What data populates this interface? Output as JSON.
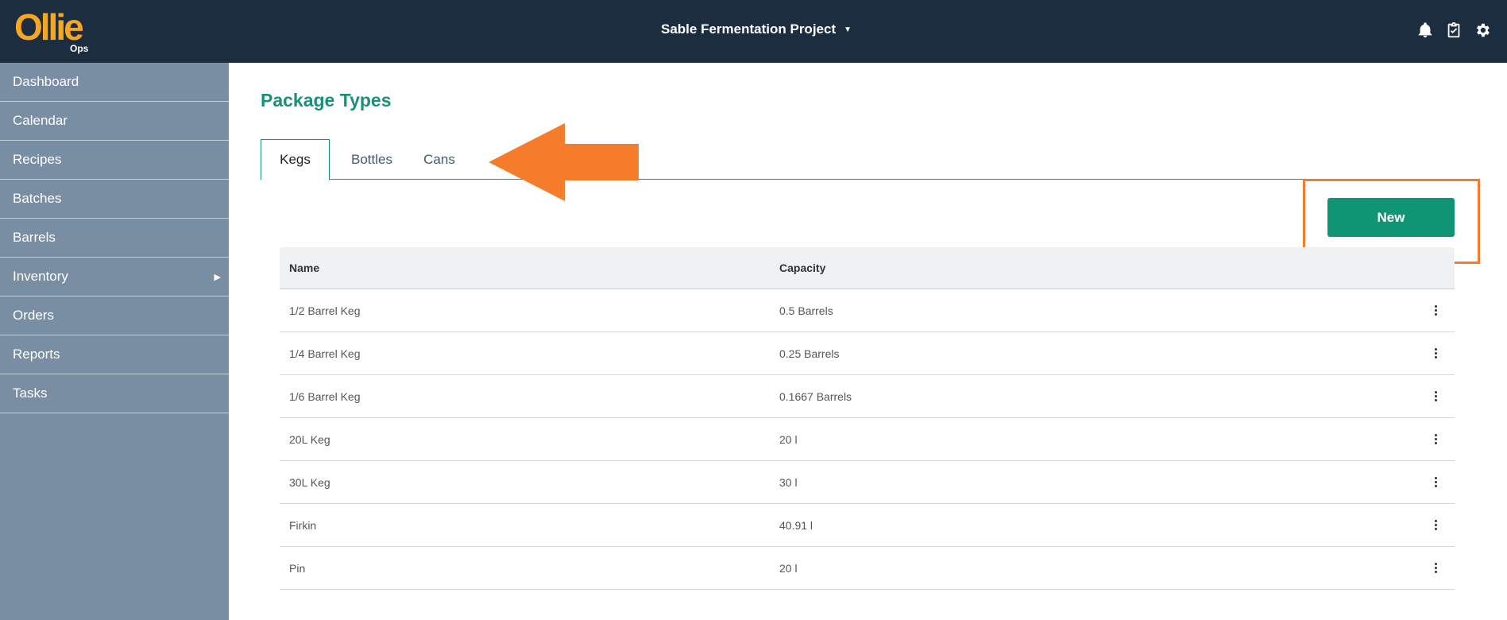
{
  "header": {
    "logo_text": "Ollie",
    "logo_sub": "Ops",
    "project_name": "Sable Fermentation Project",
    "icons": [
      "bell-icon",
      "clipboard-check-icon",
      "gear-icon"
    ]
  },
  "sidebar": {
    "items": [
      {
        "label": "Dashboard"
      },
      {
        "label": "Calendar"
      },
      {
        "label": "Recipes"
      },
      {
        "label": "Batches"
      },
      {
        "label": "Barrels"
      },
      {
        "label": "Inventory",
        "has_submenu": true
      },
      {
        "label": "Orders"
      },
      {
        "label": "Reports"
      },
      {
        "label": "Tasks"
      }
    ]
  },
  "main": {
    "title": "Package Types",
    "tabs": [
      {
        "label": "Kegs",
        "active": true
      },
      {
        "label": "Bottles",
        "active": false
      },
      {
        "label": "Cans",
        "active": false
      }
    ],
    "new_button": "New",
    "table": {
      "headers": {
        "name": "Name",
        "capacity": "Capacity"
      },
      "rows": [
        {
          "name": "1/2 Barrel Keg",
          "capacity": "0.5 Barrels"
        },
        {
          "name": "1/4 Barrel Keg",
          "capacity": "0.25 Barrels"
        },
        {
          "name": "1/6 Barrel Keg",
          "capacity": "0.1667 Barrels"
        },
        {
          "name": "20L Keg",
          "capacity": "20 l"
        },
        {
          "name": "30L Keg",
          "capacity": "30 l"
        },
        {
          "name": "Firkin",
          "capacity": "40.91 l"
        },
        {
          "name": "Pin",
          "capacity": "20 l"
        }
      ]
    }
  },
  "colors": {
    "topbar": "#1d2d40",
    "sidebar": "#7a8ea3",
    "accent": "#1a8f7a",
    "button": "#0f9474",
    "logo": "#f5a623",
    "annotation": "#f47c2b"
  }
}
